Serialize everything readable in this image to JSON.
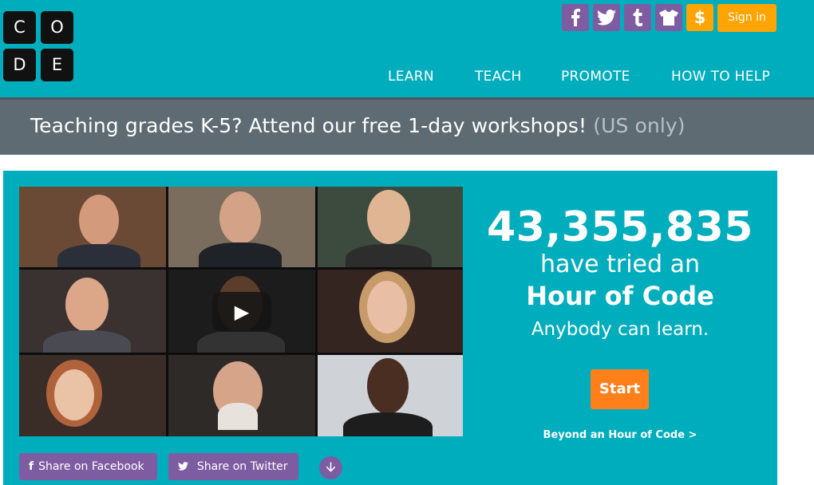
{
  "logo": {
    "letters": [
      "C",
      "O",
      "D",
      "E"
    ]
  },
  "social": {
    "facebook_glyph": "f",
    "twitter_glyph": "t",
    "tumblr_glyph": "t",
    "shop_glyph": "♟",
    "donate_glyph": "$",
    "icons": [
      "facebook-icon",
      "twitter-icon",
      "tumblr-icon",
      "tshirt-icon",
      "dollar-icon"
    ]
  },
  "header": {
    "signin_label": "Sign in",
    "nav": [
      "LEARN",
      "TEACH",
      "PROMOTE",
      "HOW TO HELP"
    ]
  },
  "banner": {
    "text": "Teaching grades K-5? Attend our free 1-day workshops!",
    "muted": "(US only)"
  },
  "hero": {
    "count": "43,355,835",
    "tried": "have tried an",
    "title": "Hour of Code",
    "tagline": "Anybody can learn.",
    "start_label": "Start",
    "beyond_label": "Beyond an Hour of Code >",
    "share_facebook": "Share on Facebook",
    "share_twitter": "Share on Twitter"
  },
  "colors": {
    "brand_teal": "#00adbc",
    "purple": "#7e5ca2",
    "orange": "#ffa400",
    "start_orange": "#ff7f1a",
    "banner_gray": "#5f6b72"
  }
}
